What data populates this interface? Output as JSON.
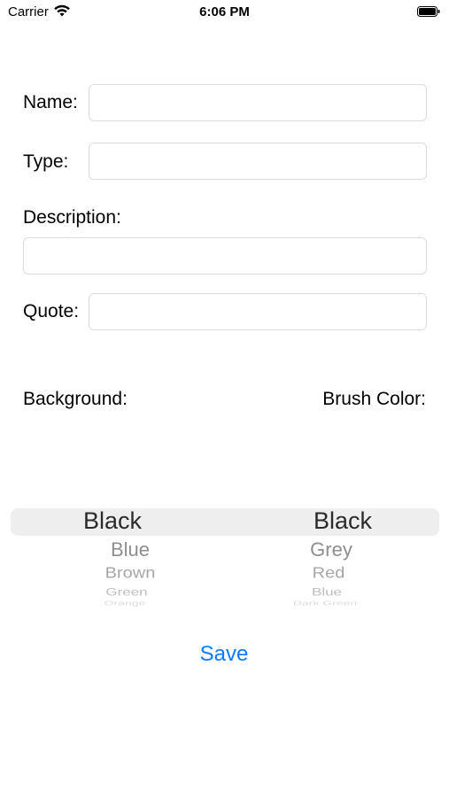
{
  "status_bar": {
    "carrier": "Carrier",
    "time": "6:06 PM"
  },
  "form": {
    "name_label": "Name:",
    "name_value": "",
    "type_label": "Type:",
    "type_value": "",
    "description_label": "Description:",
    "description_value": "",
    "quote_label": "Quote:",
    "quote_value": ""
  },
  "pickers": {
    "background_label": "Background:",
    "brush_label": "Brush Color:",
    "background": {
      "selected": "Black",
      "rows": [
        "Blue",
        "Brown",
        "Green",
        "Orange"
      ]
    },
    "brush": {
      "selected": "Black",
      "rows": [
        "Grey",
        "Red",
        "Blue",
        "Dark Green"
      ]
    }
  },
  "save_label": "Save",
  "colors": {
    "accent": "#0a7aff",
    "field_border": "#dcdcdc",
    "picker_highlight": "#eeeeef"
  }
}
